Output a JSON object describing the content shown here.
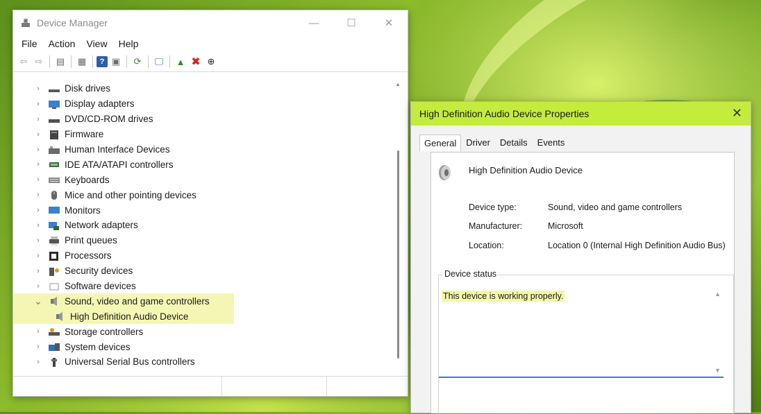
{
  "device_manager": {
    "title": "Device Manager",
    "controls": {
      "minimize": "—",
      "maximize": "☐",
      "close": "✕"
    },
    "menu": [
      "File",
      "Action",
      "View",
      "Help"
    ],
    "toolbar": [
      {
        "name": "back-icon",
        "glyph": "⇦"
      },
      {
        "name": "forward-icon",
        "glyph": "⇨"
      },
      {
        "name": "properties-icon",
        "glyph": "▤"
      },
      {
        "name": "show-hidden-icon",
        "glyph": "▦"
      },
      {
        "name": "help-icon",
        "glyph": "?"
      },
      {
        "name": "view-icon",
        "glyph": "▣"
      },
      {
        "name": "update-driver-icon",
        "glyph": "⟳"
      },
      {
        "name": "monitor-icon",
        "glyph": "🖵"
      },
      {
        "name": "enable-device-icon",
        "glyph": "▲"
      },
      {
        "name": "uninstall-icon",
        "glyph": "✖"
      },
      {
        "name": "download-icon",
        "glyph": "⊕"
      }
    ],
    "tree": [
      {
        "label": "Disk drives",
        "icon": "disk-drive-icon"
      },
      {
        "label": "Display adapters",
        "icon": "display-adapter-icon"
      },
      {
        "label": "DVD/CD-ROM drives",
        "icon": "dvd-drive-icon"
      },
      {
        "label": "Firmware",
        "icon": "firmware-icon"
      },
      {
        "label": "Human Interface Devices",
        "icon": "hid-icon"
      },
      {
        "label": "IDE ATA/ATAPI controllers",
        "icon": "ide-controller-icon"
      },
      {
        "label": "Keyboards",
        "icon": "keyboard-icon"
      },
      {
        "label": "Mice and other pointing devices",
        "icon": "mouse-icon"
      },
      {
        "label": "Monitors",
        "icon": "monitor-icon"
      },
      {
        "label": "Network adapters",
        "icon": "network-adapter-icon"
      },
      {
        "label": "Print queues",
        "icon": "printer-icon"
      },
      {
        "label": "Processors",
        "icon": "processor-icon"
      },
      {
        "label": "Security devices",
        "icon": "security-device-icon"
      },
      {
        "label": "Software devices",
        "icon": "software-device-icon"
      },
      {
        "label": "Sound, video and game controllers",
        "icon": "speaker-icon",
        "expanded": true,
        "highlighted": true
      },
      {
        "label": "High Definition Audio Device",
        "icon": "speaker-icon",
        "child": true,
        "highlighted": true
      },
      {
        "label": "Storage controllers",
        "icon": "storage-controller-icon"
      },
      {
        "label": "System devices",
        "icon": "system-device-icon"
      },
      {
        "label": "Universal Serial Bus controllers",
        "icon": "usb-icon"
      }
    ]
  },
  "properties": {
    "title": "High Definition Audio Device Properties",
    "close": "✕",
    "tabs": [
      "General",
      "Driver",
      "Details",
      "Events"
    ],
    "active_tab": "General",
    "device_name": "High Definition Audio Device",
    "rows": [
      {
        "label": "Device type:",
        "value": "Sound, video and game controllers"
      },
      {
        "label": "Manufacturer:",
        "value": "Microsoft"
      },
      {
        "label": "Location:",
        "value": "Location 0 (Internal High Definition Audio Bus)"
      }
    ],
    "status_label": "Device status",
    "status_text": "This device is working properly."
  },
  "colors": {
    "dialog_title_bg": "#c3ec3c",
    "highlight": "#f4f7b4",
    "focus_line": "#3a7bd5",
    "uninstall_red": "#e01b1b"
  }
}
